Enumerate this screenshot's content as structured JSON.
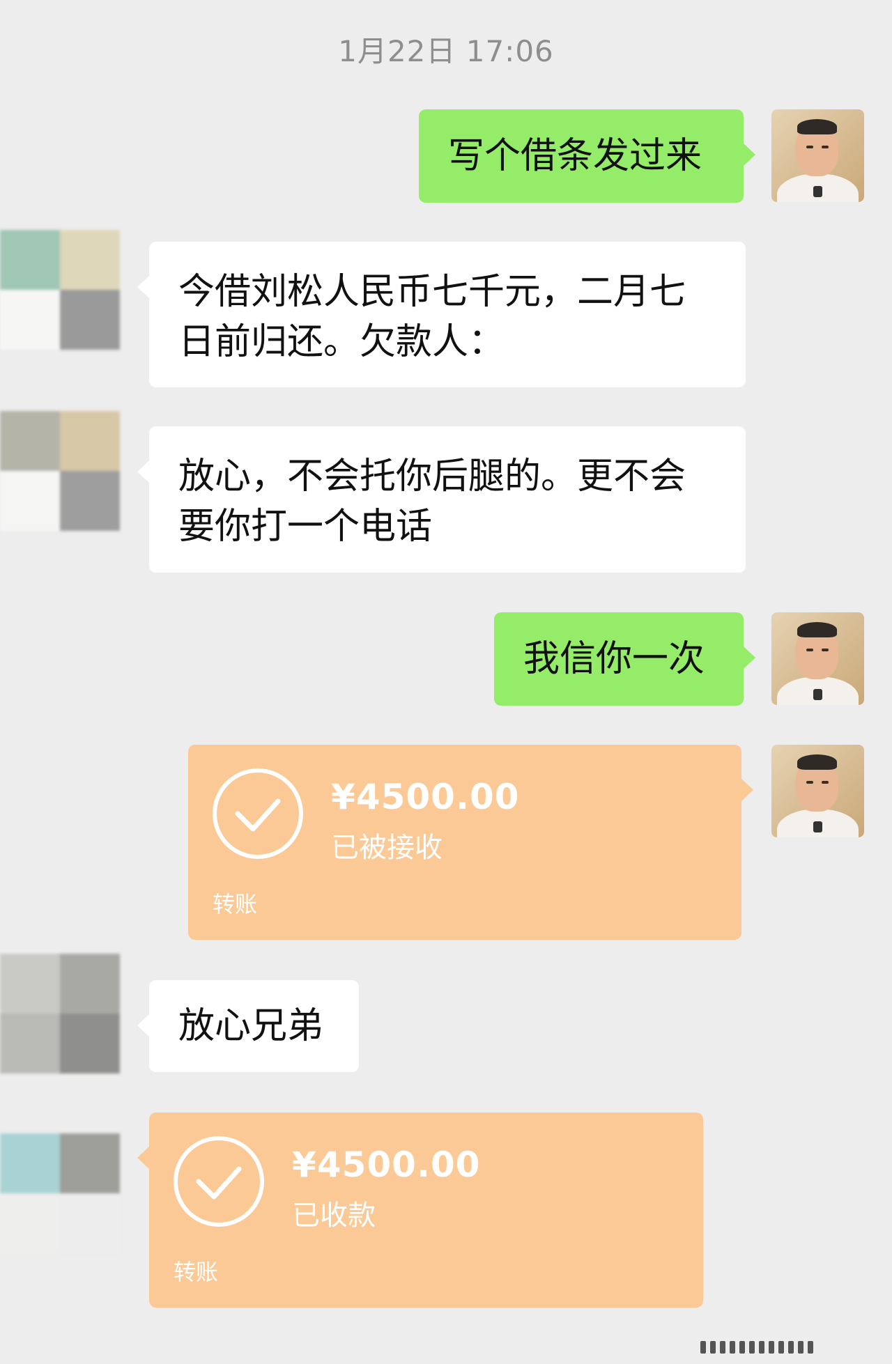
{
  "timestamp": "1月22日 17:06",
  "messages": {
    "m1": "写个借条发过来",
    "m2_line1": "今借刘松人民币七千元，二月七",
    "m2_line2": "日前归还。欠款人：",
    "m3_line1": "放心，不会托你后腿的。更不会",
    "m3_line2": "要你打一个电话",
    "m4": "我信你一次",
    "m6": "放心兄弟"
  },
  "transfer_sent": {
    "amount": "¥4500.00",
    "status": "已被接收",
    "label": "转账"
  },
  "transfer_received": {
    "amount": "¥4500.00",
    "status": "已收款",
    "label": "转账"
  },
  "colors": {
    "background": "#ededed",
    "my_bubble": "#95ec69",
    "other_bubble": "#ffffff",
    "transfer": "#fbc995"
  },
  "icons": {
    "transfer_check": "check-circle-icon"
  }
}
